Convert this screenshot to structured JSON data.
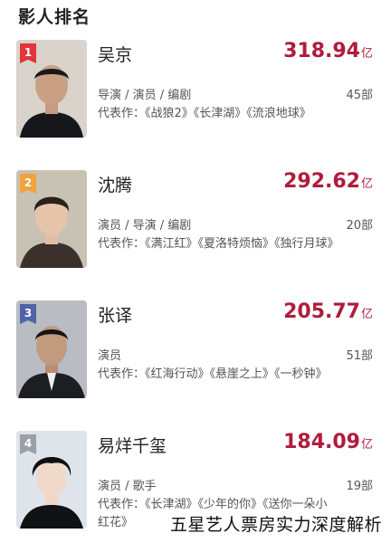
{
  "section_title": "影人排名",
  "colors": {
    "accent": "#b01c3c",
    "rank1": "#e0363c",
    "rank2": "#f0a23b",
    "rank3": "#4f63a8",
    "rank4": "#9aa0a6"
  },
  "people": [
    {
      "rank": "1",
      "name": "吴京",
      "box_value": "318.94",
      "box_unit": "亿",
      "roles": "导演 / 演员 / 编剧",
      "count": "45部",
      "works": "代表作：《战狼2》《长津湖》《流浪地球》",
      "photo": "portrait-photo-wu-jing"
    },
    {
      "rank": "2",
      "name": "沈腾",
      "box_value": "292.62",
      "box_unit": "亿",
      "roles": "演员 / 导演 / 编剧",
      "count": "20部",
      "works": "代表作：《满江红》《夏洛特烦恼》《独行月球》",
      "photo": "portrait-photo-shen-teng"
    },
    {
      "rank": "3",
      "name": "张译",
      "box_value": "205.77",
      "box_unit": "亿",
      "roles": "演员",
      "count": "51部",
      "works": "代表作：《红海行动》《悬崖之上》《一秒钟》",
      "photo": "portrait-photo-zhang-yi"
    },
    {
      "rank": "4",
      "name": "易烊千玺",
      "box_value": "184.09",
      "box_unit": "亿",
      "roles": "演员 / 歌手",
      "count": "19部",
      "works": "代表作：《长津湖》《少年的你》《送你一朵小红花》",
      "photo": "portrait-photo-yi-yang-qian-xi"
    }
  ],
  "watermark": "五星艺人票房实力深度解析"
}
